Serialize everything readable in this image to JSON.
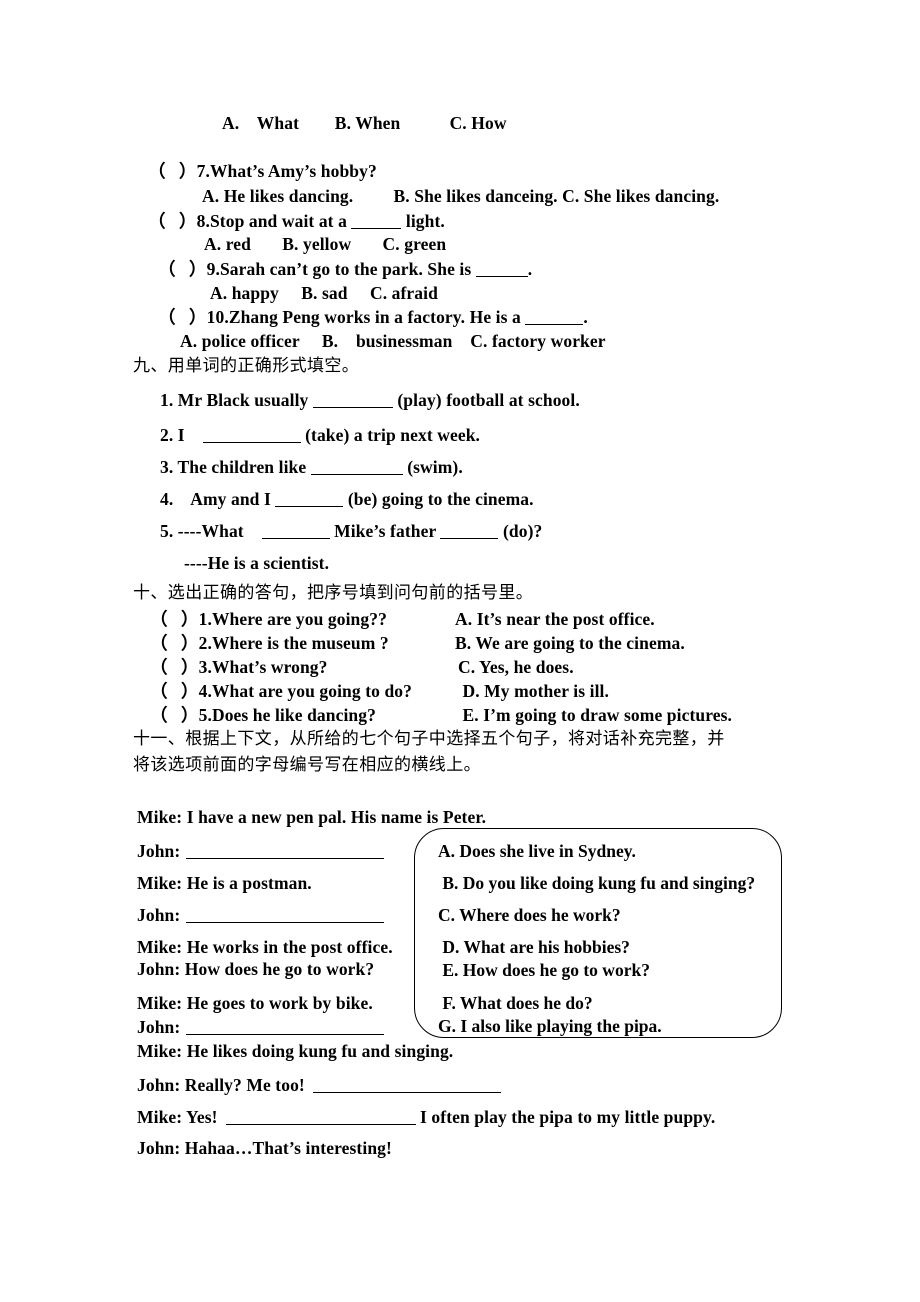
{
  "document": {
    "type": "english-exam-worksheet",
    "page_background": "#ffffff",
    "text_color": "#000000"
  },
  "carryover_options": {
    "line": "A.    What        B. When           C. How"
  },
  "section_eight_items": [
    {
      "bracket": "（   ）",
      "number": "7.",
      "question": "What’s Amy’s hobby?",
      "options": "A. He likes dancing.         B. She likes danceing. C. She likes dancing."
    },
    {
      "bracket": "（   ）",
      "number": "8.",
      "question_pre": "Stop and wait at a ",
      "question_post": " light.",
      "options": "A. red       B. yellow       C. green"
    },
    {
      "bracket": "（   ）",
      "number": "9.",
      "question_pre": "Sarah can’t go to the park. She is ",
      "question_post": ".",
      "options": "A. happy     B. sad     C. afraid"
    },
    {
      "bracket": "（   ）",
      "number": "10.",
      "question_pre": "Zhang Peng works in a factory. He is a ",
      "question_post": ".",
      "options": "A. police officer     B.    businessman    C. factory worker"
    }
  ],
  "section_nine": {
    "heading": "九、用单词的正确形式填空。",
    "items": [
      {
        "number": "1.",
        "pre": " Mr Black usually ",
        "post": " (play) football at school."
      },
      {
        "number": "2.",
        "pre": " I    ",
        "post": " (take) a trip next week."
      },
      {
        "number": "3.",
        "pre": " The children like ",
        "post": " (swim)."
      },
      {
        "number": "4.",
        "pre": "    Amy and I ",
        "post": " (be) going to the cinema."
      },
      {
        "number": "5.",
        "pre": " ----What    ",
        "mid": " Mike’s father ",
        "post": " (do)?"
      },
      {
        "answer": "----He is a scientist."
      }
    ]
  },
  "section_ten": {
    "heading": "十、选出正确的答句，把序号填到问句前的括号里。",
    "rows": [
      {
        "bracket": "（   ）",
        "number": "1.",
        "question": "Where are you going??",
        "answer": "A. It’s near the post office."
      },
      {
        "bracket": "（   ）",
        "number": "2.",
        "question": "Where is the museum ?",
        "answer": "B. We are going to the cinema."
      },
      {
        "bracket": "（   ）",
        "number": "3.",
        "question": "What’s wrong?",
        "answer": "C. Yes, he does."
      },
      {
        "bracket": "（   ）",
        "number": "4.",
        "question": "What are you going to do?",
        "answer": " D. My mother is ill."
      },
      {
        "bracket": "（   ）",
        "number": "5.",
        "question": "Does he like dancing?",
        "answer": " E. I’m going to draw some pictures."
      }
    ]
  },
  "section_eleven": {
    "heading_line1": "十一、根据上下文，从所给的七个句子中选择五个句子，将对话补充完整，并",
    "heading_line2": "将该选项前面的字母编号写在相应的横线上。",
    "dialogue": [
      {
        "speaker": "Mike:",
        "text": " I have a new pen pal. His name is Peter.",
        "blank": false
      },
      {
        "speaker": "John:",
        "text": "",
        "blank": true
      },
      {
        "speaker": "Mike:",
        "text": " He is a postman.",
        "blank": false
      },
      {
        "speaker": "John:",
        "text": "",
        "blank": true
      },
      {
        "speaker": "Mike:",
        "text": " He works in the post office.",
        "blank": false
      },
      {
        "speaker": "John:",
        "text": " How does he go to work?",
        "blank": false
      },
      {
        "speaker": "Mike:",
        "text": " He goes to work by bike.",
        "blank": false
      },
      {
        "speaker": "John:",
        "text": "",
        "blank": true
      },
      {
        "speaker": "Mike:",
        "text": " He likes doing kung fu and singing.",
        "blank": false
      },
      {
        "speaker": "John:",
        "text": " Really? Me too!",
        "blank": true
      },
      {
        "speaker": "Mike:",
        "text": " Yes!",
        "blank": true,
        "tail": " I often play the pipa to my little puppy."
      },
      {
        "speaker": "John:",
        "text": " Hahaa…That’s interesting!",
        "blank": false
      }
    ],
    "options": [
      "A. Does she live in Sydney.",
      " B. Do you like doing kung fu and singing?",
      "C. Where does he work?",
      " D. What are his hobbies?",
      " E. How does he go to work?",
      " F. What does he do?",
      "G. I also like playing the pipa."
    ]
  }
}
